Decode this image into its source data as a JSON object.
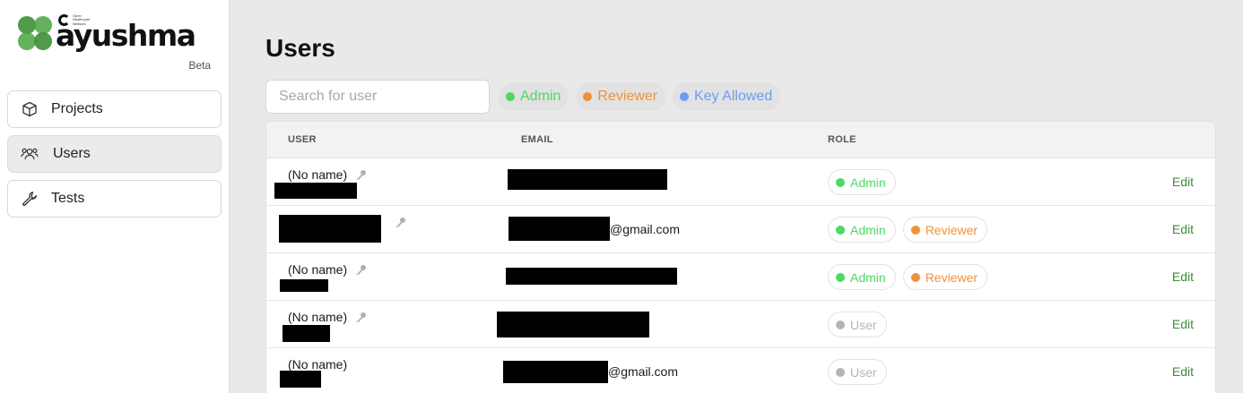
{
  "brand": {
    "wordmark": "ayushma",
    "sub_org": "Open Healthcare Network",
    "badge": "Beta"
  },
  "sidebar": {
    "items": [
      {
        "label": "Projects",
        "icon": "cube-icon",
        "active": false
      },
      {
        "label": "Users",
        "icon": "users-icon",
        "active": true
      },
      {
        "label": "Tests",
        "icon": "wrench-icon",
        "active": false
      }
    ]
  },
  "page": {
    "title": "Users",
    "search_placeholder": "Search for user"
  },
  "legend": [
    {
      "label": "Admin",
      "color": "#4cd964"
    },
    {
      "label": "Reviewer",
      "color": "#f0913a"
    },
    {
      "label": "Key Allowed",
      "color": "#6b9cf7"
    }
  ],
  "colors": {
    "admin": "#4cd964",
    "reviewer": "#f0913a",
    "key_allowed": "#6b9cf7",
    "user": "#b5b5b5",
    "edit": "#3c8d3c"
  },
  "table": {
    "headers": {
      "user": "USER",
      "email": "EMAIL",
      "role": "ROLE"
    },
    "edit_label": "Edit",
    "rows": [
      {
        "name": "(No name)",
        "key": true,
        "email_suffix": "",
        "roles": [
          {
            "label": "Admin",
            "kind": "admin"
          }
        ]
      },
      {
        "name": "",
        "key": true,
        "email_suffix": "@gmail.com",
        "roles": [
          {
            "label": "Admin",
            "kind": "admin"
          },
          {
            "label": "Reviewer",
            "kind": "reviewer"
          }
        ]
      },
      {
        "name": "(No name)",
        "key": true,
        "email_suffix": "",
        "roles": [
          {
            "label": "Admin",
            "kind": "admin"
          },
          {
            "label": "Reviewer",
            "kind": "reviewer"
          }
        ]
      },
      {
        "name": "(No name)",
        "key": true,
        "email_suffix": "",
        "roles": [
          {
            "label": "User",
            "kind": "user"
          }
        ]
      },
      {
        "name": "(No name)",
        "key": false,
        "email_suffix": "@gmail.com",
        "roles": [
          {
            "label": "User",
            "kind": "user"
          }
        ]
      }
    ]
  }
}
